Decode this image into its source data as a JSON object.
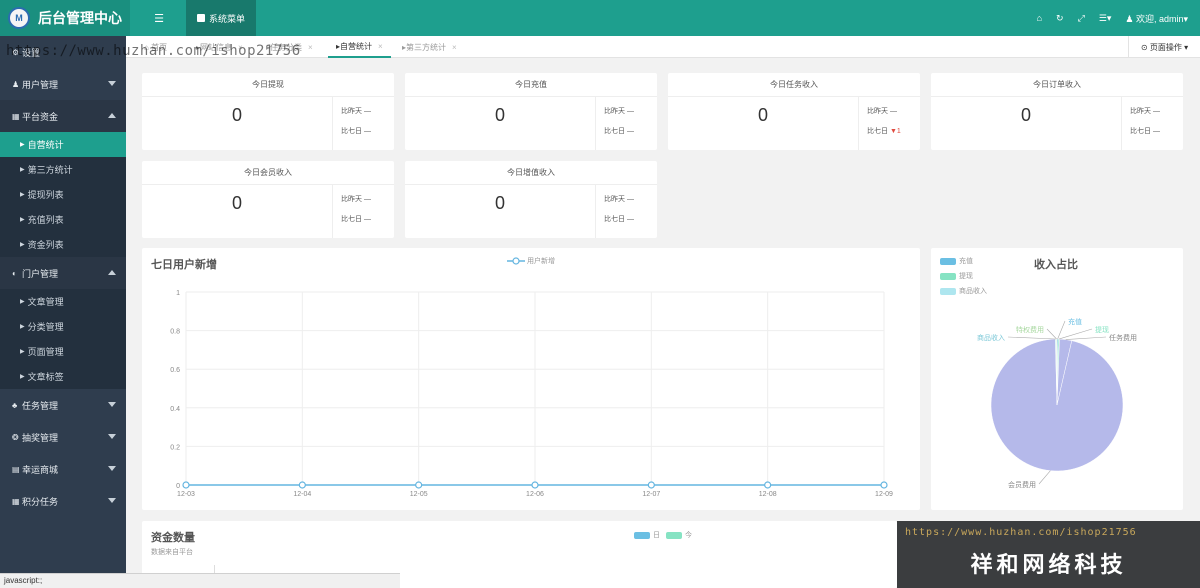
{
  "app": {
    "logo_text": "M",
    "title": "后台管理中心"
  },
  "topbar": {
    "menu_toggle_icon": "menu-icon",
    "system_menu_label": "系统菜单",
    "home_icon": "home-icon",
    "refresh_icon": "refresh-icon",
    "fullscreen_icon": "fullscreen-icon",
    "list_icon": "list-icon",
    "welcome_label": "欢迎, admin"
  },
  "sidebar": {
    "groups": [
      {
        "label": "设置"
      },
      {
        "label": "用户管理"
      },
      {
        "label": "平台资金",
        "open": true,
        "items": [
          "自营统计",
          "第三方统计",
          "提现列表",
          "充值列表",
          "资金列表"
        ]
      },
      {
        "label": "门户管理",
        "open": true,
        "items": [
          "文章管理",
          "分类管理",
          "页面管理",
          "文章标签"
        ]
      },
      {
        "label": "任务管理"
      },
      {
        "label": "抽奖管理"
      },
      {
        "label": "幸运商城"
      },
      {
        "label": "积分任务"
      }
    ]
  },
  "tabs": [
    "首页",
    "网站信息",
    "任务分类",
    "自营统计",
    "第三方统计"
  ],
  "tab_close": "×",
  "page_ops_label": "页面操作",
  "stats": [
    {
      "title": "今日提现",
      "value": "0",
      "day_label": "比昨天",
      "day_val": "—",
      "week_label": "比七日",
      "week_val": "—"
    },
    {
      "title": "今日充值",
      "value": "0",
      "day_label": "比昨天",
      "day_val": "—",
      "week_label": "比七日",
      "week_val": "—"
    },
    {
      "title": "今日任务收入",
      "value": "0",
      "day_label": "比昨天",
      "day_val": "—",
      "week_label": "比七日",
      "week_val": "▼1"
    },
    {
      "title": "今日订单收入",
      "value": "0",
      "day_label": "比昨天",
      "day_val": "—",
      "week_label": "比七日",
      "week_val": "—"
    },
    {
      "title": "今日会员收入",
      "value": "0",
      "day_label": "比昨天",
      "day_val": "—",
      "week_label": "比七日",
      "week_val": "—"
    },
    {
      "title": "今日增值收入",
      "value": "0",
      "day_label": "比昨天",
      "day_val": "—",
      "week_label": "比七日",
      "week_val": "—"
    }
  ],
  "line_chart": {
    "title": "七日用户新增",
    "legend": "用户新增",
    "color": "#64b5e0"
  },
  "pie_chart": {
    "title": "收入占比",
    "legend": [
      {
        "label": "充值",
        "color": "#6bbfe3"
      },
      {
        "label": "提现",
        "color": "#86e3c3"
      },
      {
        "label": "商品收入",
        "color": "#aee6ef"
      }
    ],
    "labels": [
      "充值",
      "提现",
      "任务费用",
      "会员费用",
      "商品收入",
      "特权费用"
    ]
  },
  "funds": {
    "title": "资金数量",
    "subtitle": "数据来自平台",
    "legend": [
      "日",
      "今"
    ],
    "legend_colors": [
      "#6bbfe3",
      "#86e3c3"
    ]
  },
  "watermark": "https://www.huzhan.com/ishop21756",
  "banner": {
    "url": "https://www.huzhan.com/ishop21756",
    "name": "祥和网络科技"
  },
  "statusbar": "javascript:;",
  "chart_data": [
    {
      "type": "line",
      "title": "七日用户新增",
      "x": [
        "12-03",
        "12-04",
        "12-05",
        "12-06",
        "12-07",
        "12-08",
        "12-09"
      ],
      "yticks": [
        "0",
        "0.2",
        "0.4",
        "0.6",
        "0.8",
        "1"
      ],
      "series": [
        {
          "name": "用户新增",
          "values": [
            0,
            0,
            0,
            0,
            0,
            0,
            0
          ]
        }
      ],
      "ylim": [
        0,
        1
      ],
      "grid": true,
      "legend": "top-center"
    },
    {
      "type": "pie",
      "title": "收入占比",
      "slices": [
        {
          "name": "充值",
          "value": 0.3
        },
        {
          "name": "提现",
          "value": 0.3
        },
        {
          "name": "任务费用",
          "value": 3
        },
        {
          "name": "会员费用",
          "value": 96
        },
        {
          "name": "商品收入",
          "value": 0.2
        },
        {
          "name": "特权费用",
          "value": 0.2
        }
      ],
      "colors": [
        "#6bbfe3",
        "#86e3c3",
        "#b5b9ea",
        "#b5b9ea",
        "#aee6ef",
        "#c7ecc5"
      ],
      "legend": "top-left"
    }
  ]
}
